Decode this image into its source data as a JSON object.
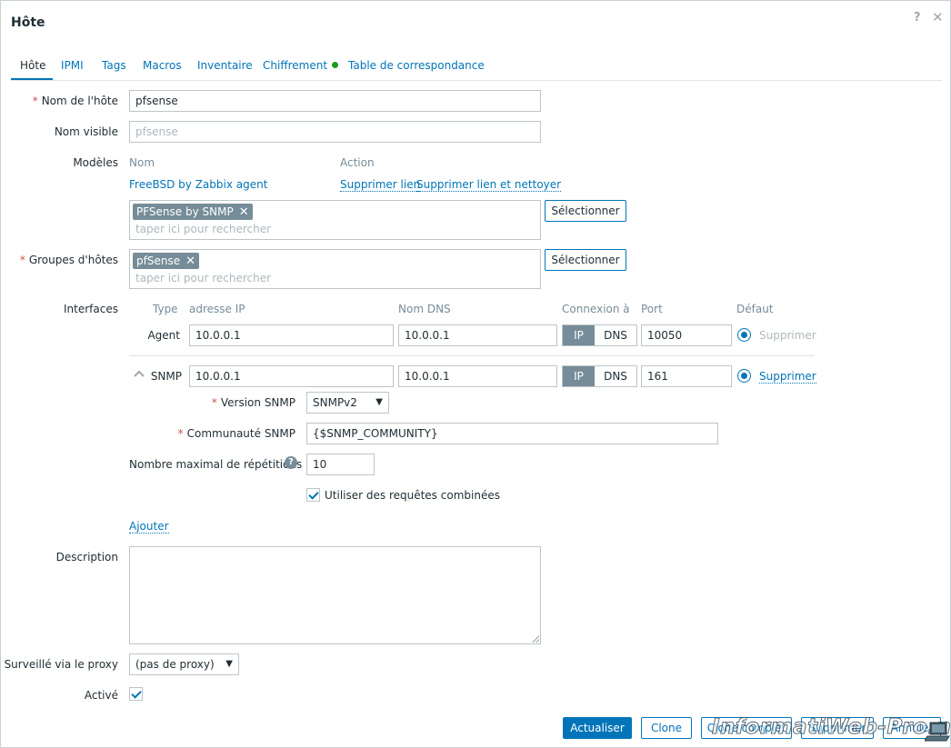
{
  "dialog": {
    "title": "Hôte",
    "help_glyph": "?",
    "close_glyph": "✕"
  },
  "tabs": [
    {
      "label": "Hôte",
      "active": true
    },
    {
      "label": "IPMI"
    },
    {
      "label": "Tags"
    },
    {
      "label": "Macros"
    },
    {
      "label": "Inventaire"
    },
    {
      "label": "Chiffrement",
      "status_color": "#1c9c1c"
    },
    {
      "label": "Table de correspondance"
    }
  ],
  "form": {
    "host_name": {
      "label": "Nom de l'hôte",
      "value": "pfsense"
    },
    "visible_name": {
      "label": "Nom visible",
      "placeholder": "pfsense"
    },
    "templates": {
      "label": "Modèles",
      "col_name": "Nom",
      "col_action": "Action",
      "linked": [
        {
          "name": "FreeBSD by Zabbix agent",
          "unlink": "Supprimer lien",
          "unlink_clear": "Supprimer lien et nettoyer"
        }
      ],
      "chips": [
        "PFSense by SNMP"
      ],
      "placeholder": "taper ici pour rechercher",
      "select_button": "Sélectionner"
    },
    "host_groups": {
      "label": "Groupes d'hôtes",
      "chips": [
        "pfSense"
      ],
      "placeholder": "taper ici pour rechercher",
      "select_button": "Sélectionner"
    },
    "interfaces": {
      "label": "Interfaces",
      "headers": {
        "type": "Type",
        "ip": "adresse IP",
        "dns": "Nom DNS",
        "connect": "Connexion à",
        "port": "Port",
        "default": "Défaut"
      },
      "rows": [
        {
          "type": "Agent",
          "ip": "10.0.0.1",
          "dns": "10.0.0.1",
          "ip_btn": "IP",
          "dns_btn": "DNS",
          "port": "10050",
          "remove": "Supprimer"
        },
        {
          "type": "SNMP",
          "ip": "10.0.0.1",
          "dns": "10.0.0.1",
          "ip_btn": "IP",
          "dns_btn": "DNS",
          "port": "161",
          "remove": "Supprimer"
        }
      ],
      "snmp": {
        "version_label": "Version SNMP",
        "version_value": "SNMPv2",
        "community_label": "Communauté SNMP",
        "community_value": "{$SNMP_COMMUNITY}",
        "max_rep_label": "Nombre maximal de répétitions",
        "max_rep_value": "10",
        "bulk_label": "Utiliser des requêtes combinées"
      },
      "add": "Ajouter"
    },
    "description": {
      "label": "Description",
      "value": ""
    },
    "proxy": {
      "label": "Surveillé via le proxy",
      "value": "(pas de proxy)"
    },
    "enabled": {
      "label": "Activé",
      "checked": true
    }
  },
  "footer": {
    "update": "Actualiser",
    "clone": "Clone",
    "full_clone": "Clone complet",
    "delete": "Supprimer",
    "cancel": "Annuler"
  },
  "watermark": "InformatiWeb-Pro.net",
  "colors": {
    "accent": "#0275b8",
    "chip": "#768d99",
    "required": "#d64e4e"
  }
}
